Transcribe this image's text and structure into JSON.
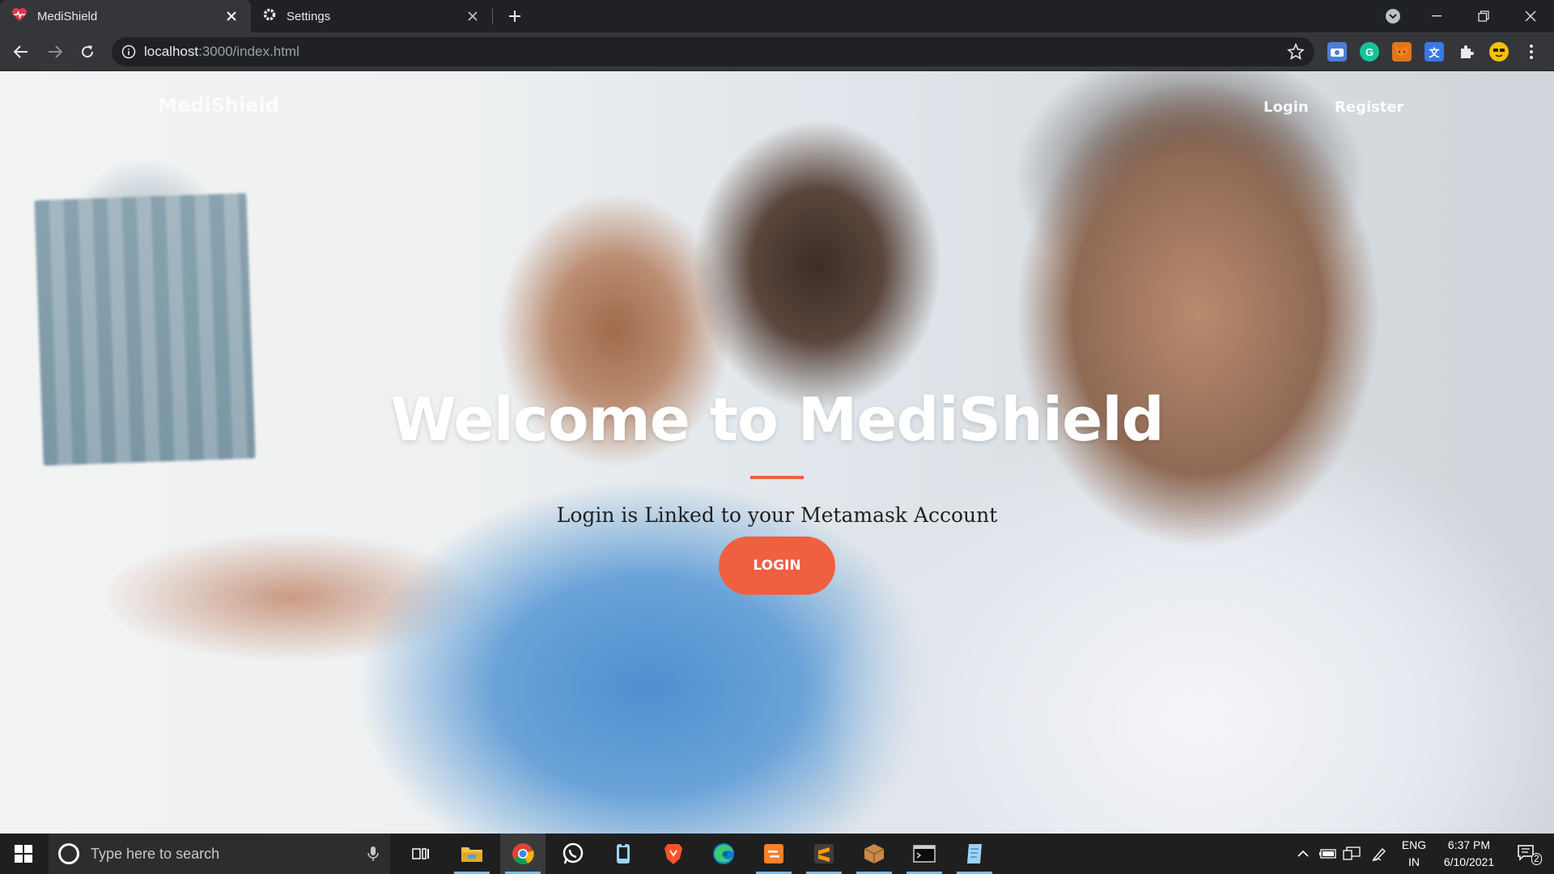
{
  "browser": {
    "tabs": [
      {
        "title": "MediShield",
        "active": true
      },
      {
        "title": "Settings",
        "active": false
      }
    ],
    "url_host": "localhost",
    "url_path": ":3000/index.html"
  },
  "page": {
    "brand": "MediShield",
    "nav": {
      "login": "Login",
      "register": "Register"
    },
    "hero_title": "Welcome to MediShield",
    "hero_subtitle": "Login is Linked to your Metamask Account",
    "login_button": "LOGIN"
  },
  "taskbar": {
    "search_placeholder": "Type here to search",
    "language": "ENG",
    "region": "IN",
    "time": "6:37 PM",
    "date": "6/10/2021",
    "notification_count": "2"
  },
  "colors": {
    "accent": "#f05f40",
    "chrome_dark": "#202124",
    "chrome_toolbar": "#35363a"
  }
}
